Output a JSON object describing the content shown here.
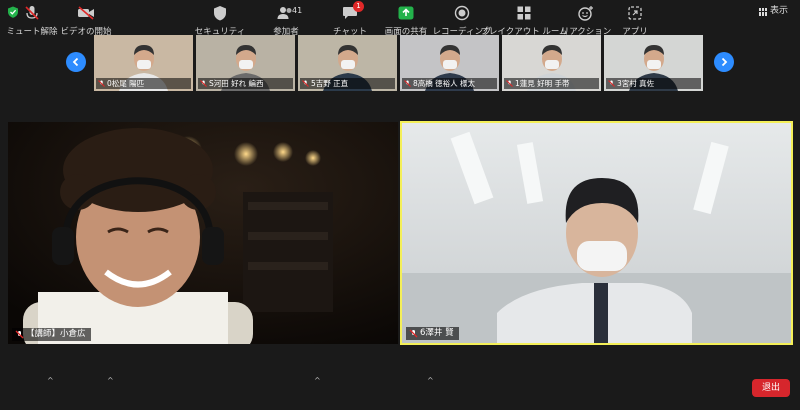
{
  "header": {
    "view_label": "表示"
  },
  "thumbnails": [
    {
      "label": "0松尾 陽匹",
      "bg": "#c9b8a3",
      "shirt": "#e8e8e8"
    },
    {
      "label": "S河田 好れ 編西",
      "bg": "#b9b2a4",
      "shirt": "#6b6b6b"
    },
    {
      "label": "5吉野 正直",
      "bg": "#bdb6a6",
      "shirt": "#2b3a4a"
    },
    {
      "label": "8高橋 徳裕人 様太",
      "bg": "#c4c4c6",
      "shirt": "#2f3b4c"
    },
    {
      "label": "1蓮見 好明 手帯",
      "bg": "#d8d7d4",
      "shirt": "#cfd3d6"
    },
    {
      "label": "3宮村 真佐",
      "bg": "#d4d6d4",
      "shirt": "#2f3a47"
    }
  ],
  "videos": {
    "left": {
      "label": "【講師】小倉広"
    },
    "right": {
      "label": "6澤井 賢"
    }
  },
  "toolbar": {
    "mute": "ミュート解除",
    "video": "ビデオの開始",
    "security": "セキュリティ",
    "participants": "参加者",
    "participants_count": "41",
    "chat": "チャット",
    "chat_badge": "1",
    "share": "画面の共有",
    "record": "レコーディング",
    "breakout": "ブレイクアウト ルーム",
    "reactions": "リアクション",
    "apps": "アプリ",
    "leave": "退出"
  },
  "colors": {
    "accent": "#2d8cff",
    "active_border": "#f4ef58",
    "leave": "#d6262c",
    "share": "#23b24b"
  }
}
